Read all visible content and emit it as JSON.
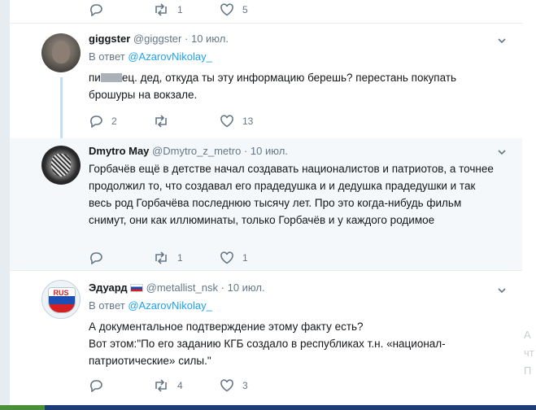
{
  "top_actions": {
    "reply_count": "",
    "retweet_count": "1",
    "like_count": "5"
  },
  "tweets": [
    {
      "name": "giggster",
      "handle": "@giggster",
      "time": "10 июл.",
      "reply_prefix": "В ответ",
      "reply_to": "@AzarovNikolay_",
      "text_before": "пи",
      "text_after": "ец. дед, откуда ты эту информацию берешь? перестань покупать брошуры на вокзале.",
      "reply_count": "2",
      "retweet_count": "",
      "like_count": "13"
    },
    {
      "name": "Dmytro May",
      "handle": "@Dmytro_z_metro",
      "time": "10 июл.",
      "text": "Горбачёв ещё в детстве начал создавать националистов и  патриотов, а точнее продолжил то, что создавал его прадедушка и и дедушка прадедушки и так весь род Горбачёва последнюю тысячу лет. Про это когда-нибудь фильм снимут, они как иллюминаты, только Горбачёв и у каждого родимое",
      "reply_count": "",
      "retweet_count": "1",
      "like_count": "1"
    },
    {
      "name": "Эдуард",
      "handle": "@metallist_nsk",
      "time": "10 июл.",
      "reply_prefix": "В ответ",
      "reply_to": "@AzarovNikolay_",
      "text_line1": "А документальное подтверждение этому факту есть?",
      "text_line2": "Вот этом:\"По его заданию КГБ создало в республиках т.н. «национал-патриотические» силы.\"",
      "reply_count": "",
      "retweet_count": "4",
      "like_count": "3",
      "avatar_text": "RUS"
    }
  ],
  "dot": "·",
  "edge_ghost_chars": [
    "А",
    "чт",
    "П"
  ]
}
